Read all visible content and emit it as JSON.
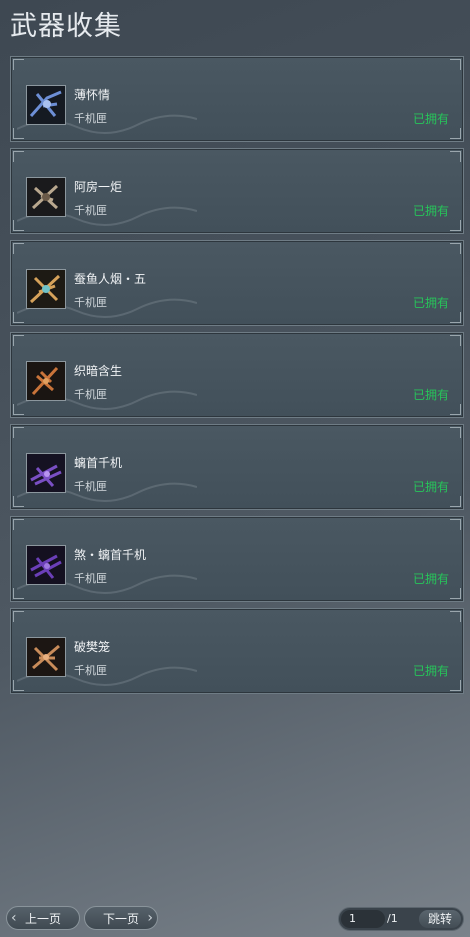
{
  "page": {
    "title": "武器收集"
  },
  "weapons": [
    {
      "name": "薄怀情",
      "category": "千机匣",
      "status": "已拥有",
      "icon": "crossbow-blue-icon",
      "tint": "#6d8fd6"
    },
    {
      "name": "阿房一炬",
      "category": "千机匣",
      "status": "已拥有",
      "icon": "crossbow-dark-icon",
      "tint": "#b9a88f"
    },
    {
      "name": "蚕鱼人烟・五",
      "category": "千机匣",
      "status": "已拥有",
      "icon": "crossbow-gold-icon",
      "tint": "#d6a25a"
    },
    {
      "name": "织暗含生",
      "category": "千机匣",
      "status": "已拥有",
      "icon": "crossbow-bronze-icon",
      "tint": "#c9743a"
    },
    {
      "name": "螭首千机",
      "category": "千机匣",
      "status": "已拥有",
      "icon": "crossbow-purple-icon",
      "tint": "#7a4fc4"
    },
    {
      "name": "煞・螭首千机",
      "category": "千机匣",
      "status": "已拥有",
      "icon": "crossbow-violet-icon",
      "tint": "#6b3fb8"
    },
    {
      "name": "破樊笼",
      "category": "千机匣",
      "status": "已拥有",
      "icon": "crossbow-copper-icon",
      "tint": "#c98c5a"
    }
  ],
  "pagination": {
    "prev_label": "上一页",
    "next_label": "下一页",
    "current_page": "1",
    "total_pages": "/1",
    "jump_label": "跳转"
  },
  "colors": {
    "owned": "#27c45a"
  }
}
